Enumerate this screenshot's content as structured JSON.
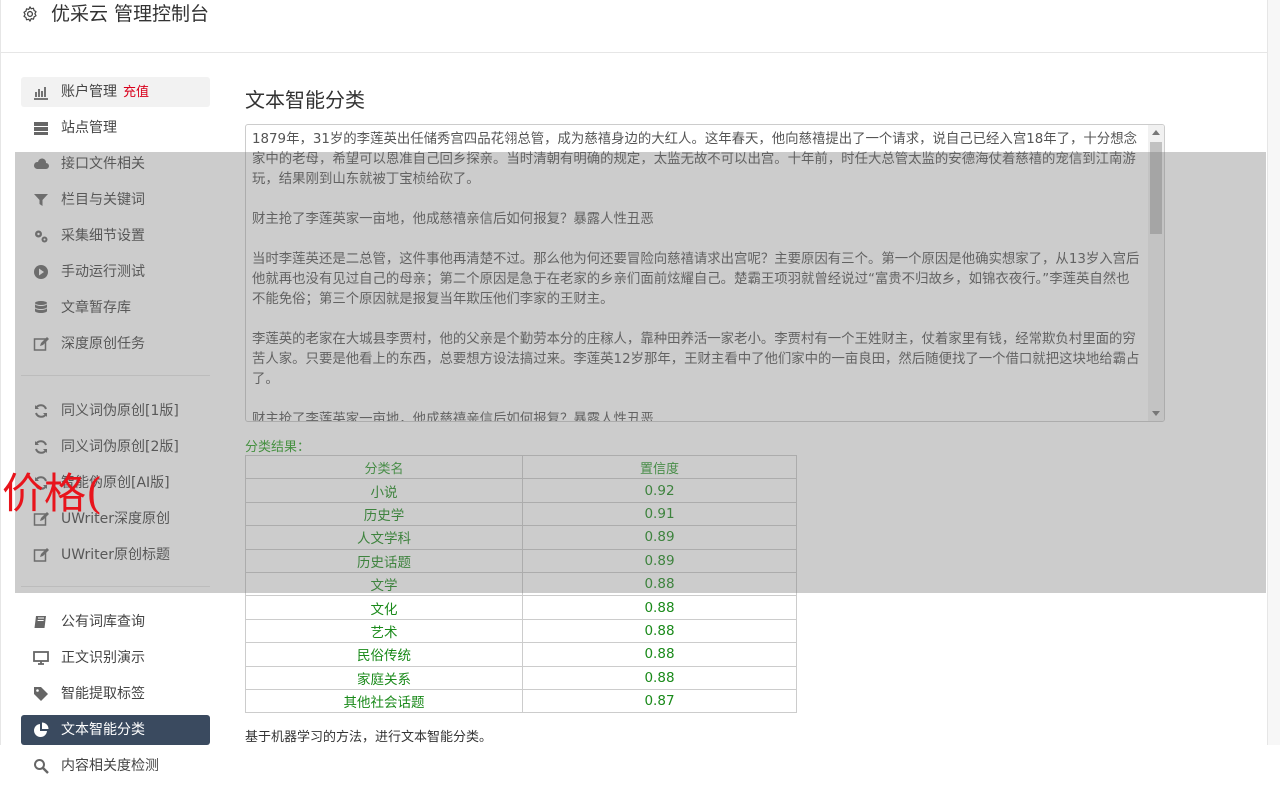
{
  "header": {
    "title": "优采云 管理控制台"
  },
  "sidebar": {
    "items": [
      {
        "label": "账户管理",
        "extra": "充值",
        "icon": "bar-chart-icon"
      },
      {
        "label": "站点管理",
        "icon": "server-icon"
      },
      {
        "label": "接口文件相关",
        "icon": "cloud-upload-icon"
      },
      {
        "label": "栏目与关键词",
        "icon": "filter-icon"
      },
      {
        "label": "采集细节设置",
        "icon": "gears-icon"
      },
      {
        "label": "手动运行测试",
        "icon": "play-circle-icon"
      },
      {
        "label": "文章暂存库",
        "icon": "database-icon"
      },
      {
        "label": "深度原创任务",
        "icon": "edit-icon"
      },
      {
        "label": "同义词伪原创[1版]",
        "icon": "refresh-icon"
      },
      {
        "label": "同义词伪原创[2版]",
        "icon": "refresh-icon"
      },
      {
        "label": "智能伪原创[AI版]",
        "icon": "refresh-icon"
      },
      {
        "label": "UWriter深度原创",
        "icon": "edit-icon"
      },
      {
        "label": "UWriter原创标题",
        "icon": "edit-icon"
      },
      {
        "label": "公有词库查询",
        "icon": "book-icon"
      },
      {
        "label": "正文识别演示",
        "icon": "monitor-icon"
      },
      {
        "label": "智能提取标签",
        "icon": "tag-icon"
      },
      {
        "label": "文本智能分类",
        "icon": "pie-chart-icon"
      },
      {
        "label": "内容相关度检测",
        "icon": "search-icon"
      }
    ]
  },
  "main": {
    "title": "文本智能分类",
    "paragraphs": [
      "1879年，31岁的李莲英出任储秀宫四品花翎总管，成为慈禧身边的大红人。这年春天，他向慈禧提出了一个请求，说自己已经入宫18年了，十分想念家中的老母，希望可以恩准自己回乡探亲。当时清朝有明确的规定，太监无故不可以出宫。十年前，时任大总管太监的安德海仗着慈禧的宠信到江南游玩，结果刚到山东就被丁宝桢给砍了。",
      "财主抢了李莲英家一亩地，他成慈禧亲信后如何报复？暴露人性丑恶",
      "当时李莲英还是二总管，这件事他再清楚不过。那么他为何还要冒险向慈禧请求出宫呢？主要原因有三个。第一个原因是他确实想家了，从13岁入宫后他就再也没有见过自己的母亲；第二个原因是急于在老家的乡亲们面前炫耀自己。楚霸王项羽就曾经说过“富贵不归故乡，如锦衣夜行。”李莲英自然也不能免俗；第三个原因就是报复当年欺压他们李家的王财主。",
      "李莲英的老家在大城县李贾村，他的父亲是个勤劳本分的庄稼人，靠种田养活一家老小。李贾村有一个王姓财主，仗着家里有钱，经常欺负村里面的穷苦人家。只要是他看上的东西，总要想方设法搞过来。李莲英12岁那年，王财主看中了他们家中的一亩良田，然后随便找了一个借口就把这块地给霸占了。",
      "财主抢了李莲英家一亩地，他成慈禧亲信后如何报复？暴露人性丑恶"
    ],
    "result_label": "分类结果：",
    "table": {
      "headers": [
        "分类名",
        "置信度"
      ],
      "rows": [
        [
          "小说",
          "0.92"
        ],
        [
          "历史学",
          "0.91"
        ],
        [
          "人文学科",
          "0.89"
        ],
        [
          "历史话题",
          "0.89"
        ],
        [
          "文学",
          "0.88"
        ],
        [
          "文化",
          "0.88"
        ],
        [
          "艺术",
          "0.88"
        ],
        [
          "民俗传统",
          "0.88"
        ],
        [
          "家庭关系",
          "0.88"
        ],
        [
          "其他社会话题",
          "0.87"
        ]
      ]
    },
    "footer": "基于机器学习的方法，进行文本智能分类。"
  },
  "overlay": {
    "text": "价格("
  },
  "colors": {
    "active_bg": "#3a4a5f",
    "result_green": "#1a8a1a",
    "recharge_red": "#d9001b",
    "overlay_red": "#e8141c"
  }
}
